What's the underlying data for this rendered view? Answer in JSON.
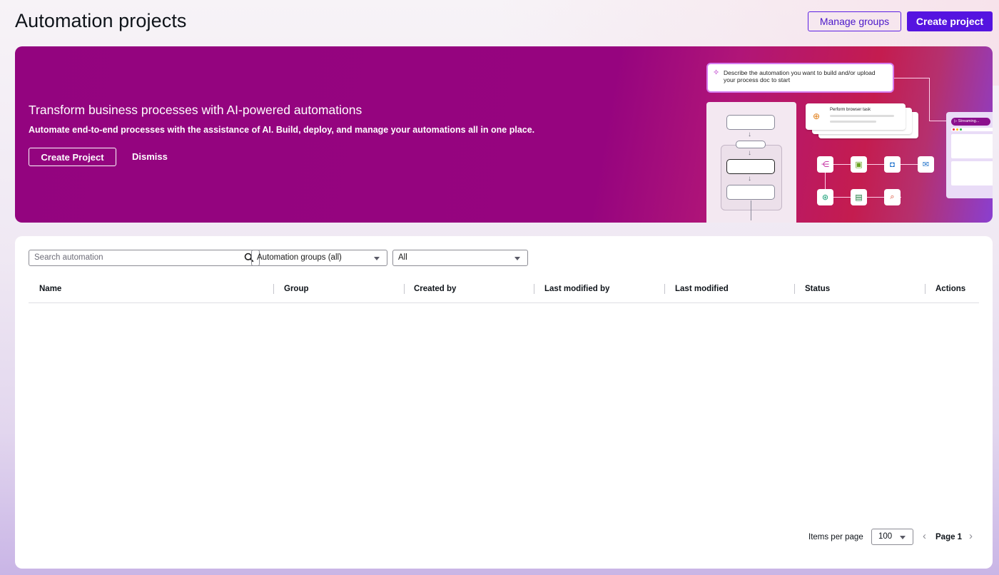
{
  "header": {
    "title": "Automation projects",
    "manage_groups_label": "Manage groups",
    "create_project_label": "Create project"
  },
  "banner": {
    "title": "Transform business processes with AI-powered automations",
    "subtitle": "Automate end-to-end processes with the assistance of AI. Build, deploy, and manage your automations all in one place.",
    "create_label": "Create Project",
    "dismiss_label": "Dismiss",
    "illustration": {
      "prompt_text": "Describe the automation you want to build and/or upload your process doc to start",
      "browser_task_label": "Perform browser task",
      "streaming_label": "▷ Streaming..."
    }
  },
  "filters": {
    "search_placeholder": "Search automation",
    "group_select_value": "Automation groups (all)",
    "status_select_value": "All"
  },
  "table": {
    "columns": [
      "Name",
      "Group",
      "Created by",
      "Last modified by",
      "Last modified",
      "Status",
      "Actions"
    ],
    "rows": []
  },
  "pagination": {
    "items_per_page_label": "Items per page",
    "items_per_page_value": "100",
    "page_label": "Page 1"
  },
  "colors": {
    "primary": "#5514e0",
    "banner": "#93047f"
  }
}
